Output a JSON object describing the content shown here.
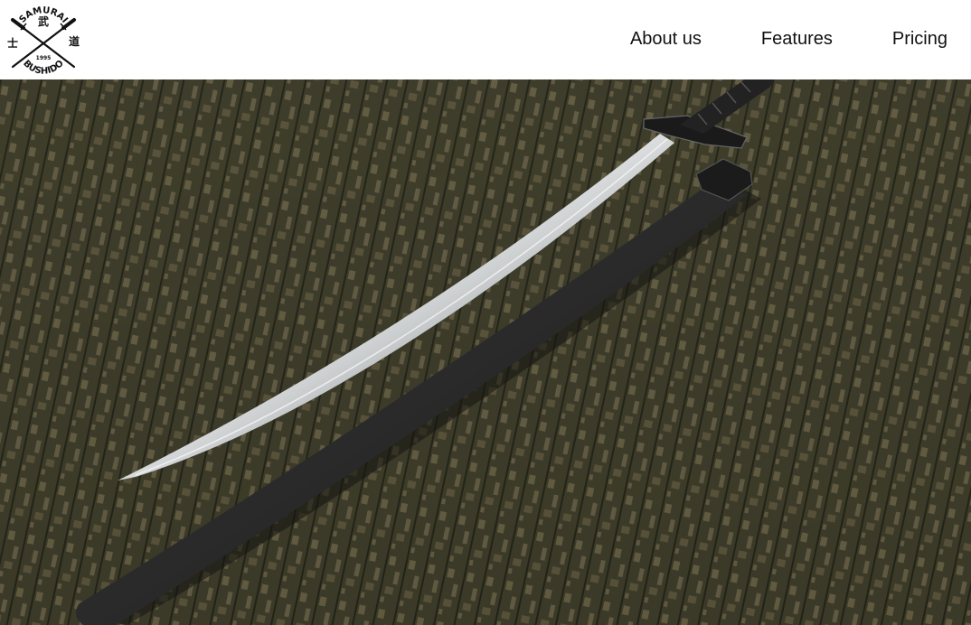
{
  "logo": {
    "top_text": "SAMURAI",
    "bottom_text": "BUSHIDO",
    "year": "1995",
    "kanji_left": "士",
    "kanji_center": "武",
    "kanji_right": "道"
  },
  "nav": {
    "items": [
      {
        "label": "About us"
      },
      {
        "label": "Features"
      },
      {
        "label": "Pricing"
      }
    ]
  },
  "hero": {
    "image": "katana-on-wooden-floor",
    "colors": {
      "floor_dark": "#2f3021",
      "floor_light": "#8a7d5e",
      "blade": "#c9cbcc",
      "scabbard": "#2b2b2b"
    }
  }
}
